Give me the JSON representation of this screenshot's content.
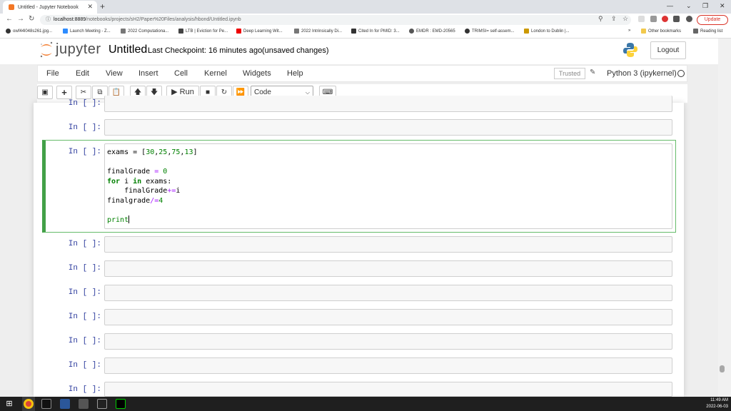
{
  "browser": {
    "tab_title": "Untitled - Jupyter Notebook",
    "url_host": "localhost:8889",
    "url_path": "/notebooks/projects/sH2/Paper%20Files/analysis/hbond/Untitled.ipynb",
    "update_label": "Update",
    "bookmarks": [
      "owf44l048s261.jpg...",
      "Launch Meeting - Z...",
      "2022 Computationa...",
      "LTB | Eviction for Pe...",
      "Deep Learning Wit...",
      "2022 Intrinsically Di...",
      "Cited In for PMID: 3...",
      "EMDR : EMD-20565",
      "TRIMSI= self-assem...",
      "London to Dublin |...",
      "Other bookmarks",
      "Reading list"
    ]
  },
  "header": {
    "logo_text": "jupyter",
    "notebook_name": "Untitled",
    "checkpoint": "Last Checkpoint: 16 minutes ago",
    "changes": "(unsaved changes)",
    "logout_label": "Logout"
  },
  "menubar": {
    "items": [
      "File",
      "Edit",
      "View",
      "Insert",
      "Cell",
      "Kernel",
      "Widgets",
      "Help"
    ],
    "trusted_label": "Trusted",
    "kernel_name": "Python 3 (ipykernel)"
  },
  "toolbar": {
    "run_label": "Run",
    "cell_type": "Code"
  },
  "cells": {
    "prompt": "In [ ]:",
    "code_lines": {
      "l1a": "exams",
      "l1b": " = [",
      "l1c": "30",
      "l1d": ",",
      "l1e": "25",
      "l1f": ",",
      "l1g": "75",
      "l1h": ",",
      "l1i": "13",
      "l1j": "]",
      "l2a": "finalGrade ",
      "l2b": "=",
      "l2c": " ",
      "l2d": "0",
      "l3a": "for",
      "l3b": " i ",
      "l3c": "in",
      "l3d": " exams:",
      "l4a": "    finalGrade",
      "l4b": "+=",
      "l4c": "i",
      "l5a": "finalgrade",
      "l5b": "/=",
      "l5c": "4",
      "l6a": "print"
    }
  },
  "taskbar": {
    "time": "11:49 AM",
    "date": "2022-06-03"
  }
}
